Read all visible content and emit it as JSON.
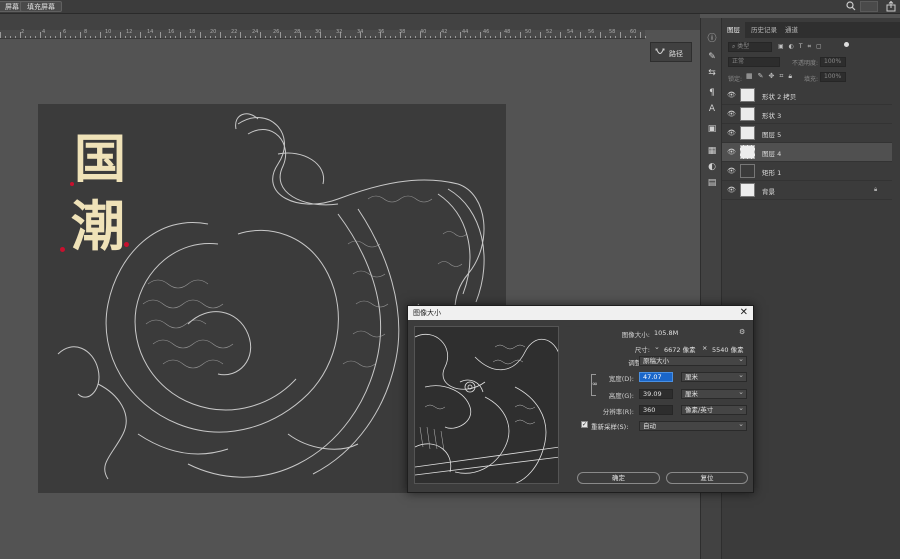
{
  "topbar": {
    "btn1": "屏幕",
    "btn2": "填充屏幕",
    "search_icon": "search-icon",
    "share_icon": "share-icon"
  },
  "ruler": {
    "labels": [
      "2",
      "4",
      "6",
      "8",
      "10",
      "12",
      "14",
      "16",
      "18",
      "20",
      "22",
      "24",
      "26",
      "28",
      "30",
      "32",
      "34",
      "36",
      "38",
      "40",
      "42",
      "44",
      "46",
      "48",
      "50",
      "52",
      "54",
      "56",
      "58",
      "60"
    ]
  },
  "paths_panel": {
    "label": "路径"
  },
  "artwork": {
    "title_char1": "国",
    "title_char2": "潮"
  },
  "layers_panel": {
    "tabs": [
      "图层",
      "历史记录",
      "通道"
    ],
    "kind_placeholder": "类型",
    "blend_mode": "正常",
    "opacity_label": "不透明度:",
    "opacity_value": "100%",
    "lock_label": "锁定:",
    "fill_label": "填充:",
    "fill_value": "100%",
    "layers": [
      {
        "name": "形状 2 拷贝"
      },
      {
        "name": "形状 3"
      },
      {
        "name": "图层 5"
      },
      {
        "name": "图层 4"
      },
      {
        "name": "矩形 1"
      },
      {
        "name": "背景"
      }
    ]
  },
  "dialog": {
    "title": "图像大小",
    "image_size_label": "图像大小:",
    "image_size_value": "105.8M",
    "dimensions_label": "尺寸:",
    "dim_w": "6672 像素",
    "dim_sep": "×",
    "dim_h": "5540 像素",
    "fit_label": "调整为:",
    "fit_value": "原稿大小",
    "width_label": "宽度(D):",
    "width_value": "47.07",
    "width_unit": "厘米",
    "height_label": "高度(G):",
    "height_value": "39.09",
    "height_unit": "厘米",
    "resolution_label": "分辨率(R):",
    "resolution_value": "360",
    "resolution_unit": "像素/英寸",
    "resample_label": "重新采样(S):",
    "resample_value": "自动",
    "ok_label": "确定",
    "reset_label": "复位"
  }
}
